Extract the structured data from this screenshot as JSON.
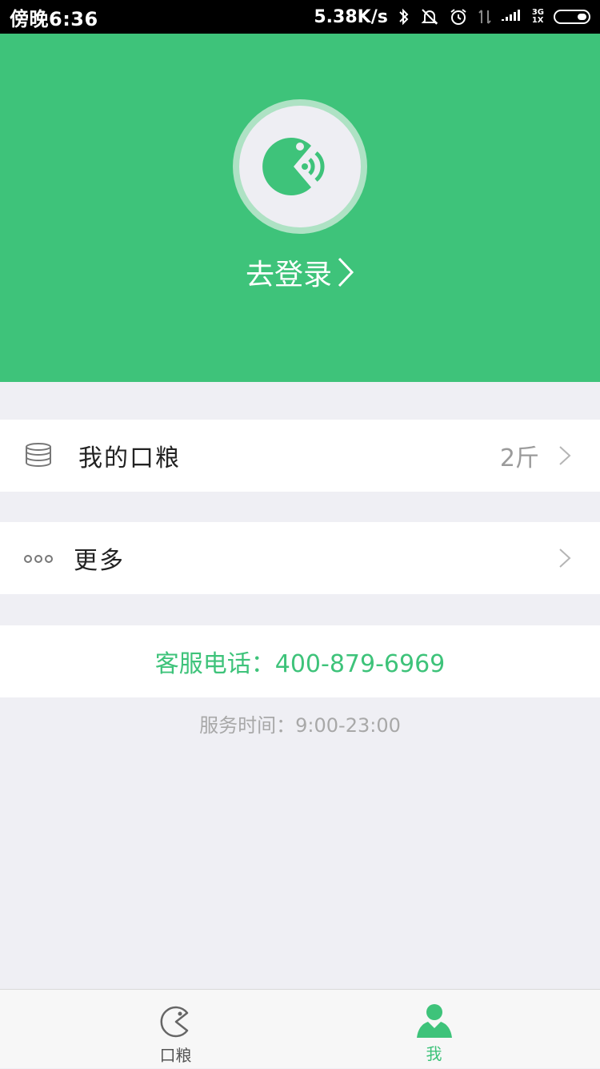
{
  "status_bar": {
    "time": "傍晚6:36",
    "net_speed": "5.38K/s",
    "net_type_top": "3G",
    "net_type_bottom": "1X",
    "battery_level": 0.3,
    "icons": [
      "bluetooth-icon",
      "mute-bell-icon",
      "alarm-icon",
      "data-arrows-icon",
      "signal-icon",
      "battery-icon"
    ]
  },
  "header": {
    "login_label": "去登录",
    "avatar_icon": "pacman-wifi-logo-icon",
    "bg_color": "#3ec37a"
  },
  "menu": {
    "rations": {
      "label": "我的口粮",
      "value": "2斤",
      "icon": "coin-stack-icon"
    },
    "more": {
      "label": "更多",
      "icon": "dots-icon"
    }
  },
  "service": {
    "phone_text": "客服电话：400-879-6969",
    "hours_text": "服务时间：9:00-23:00"
  },
  "tabbar": {
    "tabs": [
      {
        "label": "口粮",
        "icon": "pacman-icon",
        "active": false
      },
      {
        "label": "我",
        "icon": "person-icon",
        "active": true
      }
    ],
    "active_color": "#3ec37a",
    "inactive_color": "#555555"
  }
}
